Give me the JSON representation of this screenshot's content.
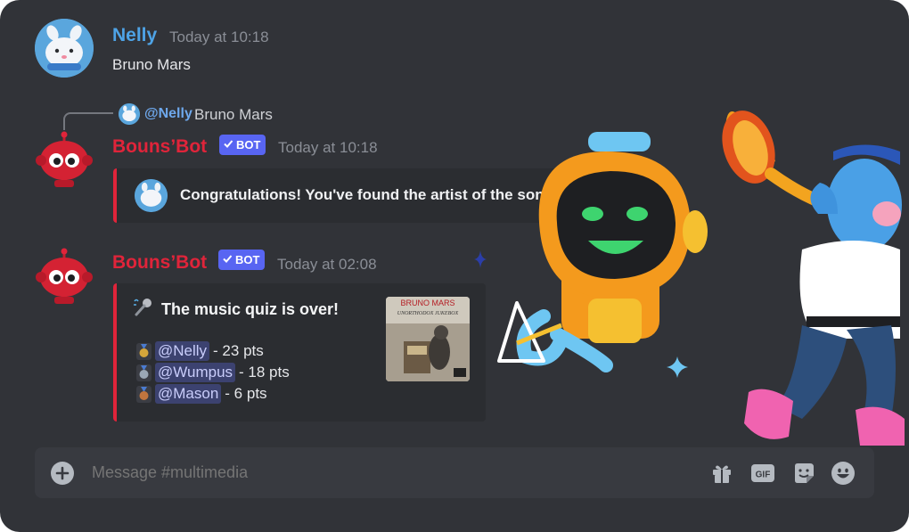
{
  "messages": {
    "nelly": {
      "username": "Nelly",
      "timestamp": "Today at 10:18",
      "text": "Bruno Mars"
    },
    "reply": {
      "mention": "@Nelly",
      "text": "Bruno Mars"
    },
    "bot1": {
      "username": "Bouns’Bot",
      "badge": "BOT",
      "timestamp": "Today at 10:18",
      "embed_text": "Congratulations! You've found the artist of the song! 🧟"
    },
    "bot2": {
      "username": "Bouns’Bot",
      "badge": "BOT",
      "timestamp": "Today at 02:08",
      "embed_title": "The music quiz is over!",
      "album_artist": "BRUNO MARS",
      "album_title": "UNORTHODOX JUKEBOX",
      "leaderboard": [
        {
          "rank": "1",
          "mention": "@Nelly",
          "score": "- 23 pts",
          "medal_color": "#d6a73b"
        },
        {
          "rank": "2",
          "mention": "@Wumpus",
          "score": "- 18 pts",
          "medal_color": "#9aa7b5"
        },
        {
          "rank": "3",
          "mention": "@Mason",
          "score": "- 6 pts",
          "medal_color": "#c0753e"
        }
      ]
    }
  },
  "composer": {
    "placeholder": "Message #multimedia",
    "gif_label": "GIF"
  },
  "colors": {
    "background": "#313338",
    "bot_name": "#e0243a",
    "nelly_name": "#4ea3e6",
    "badge": "#5865f2",
    "mention_chip": "#3c4270",
    "embed_bar": "#e0243a"
  }
}
